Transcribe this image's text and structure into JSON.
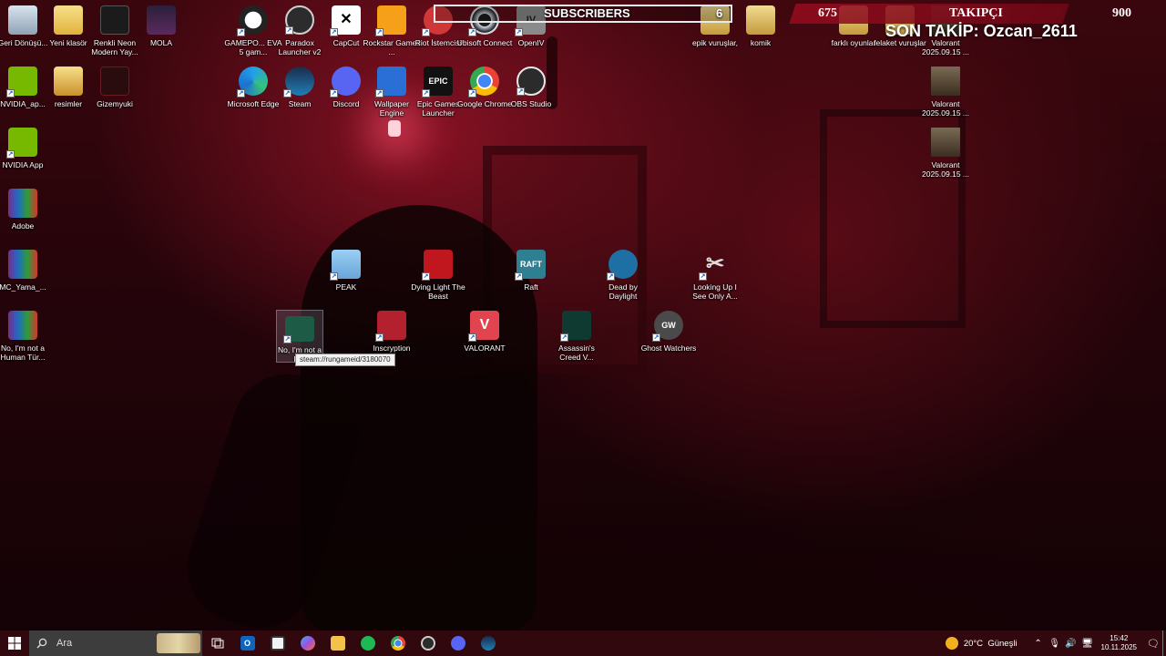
{
  "overlay": {
    "subscribers_label": "SUBSCRIBERS",
    "subscribers_count": "6",
    "follow_left": "675",
    "follow_title": "TAKIPÇI",
    "follow_right": "900",
    "last_follow": "SON TAKİP: Ozcan_2611"
  },
  "tooltip": "steam://rungameid/3180070",
  "icons": {
    "recycle": "Geri Dönüşü...",
    "new_folder": "Yeni klasör",
    "neon": "Renkli Neon Modern Yay...",
    "mola": "MOLA",
    "nvidia_app_shortcut": "NVIDIA_ap...",
    "resimler": "resimler",
    "gizemyuki": "Gizemyuki",
    "nvidia_app": "NVIDIA App",
    "adobe": "Adobe",
    "mc_yama": "MC_Yama_...",
    "no_im_not_human_left": "No, I'm not a Human Tür...",
    "gamepop": "GAMEPO... EVA 5 gam...",
    "paradox": "Paradox Launcher v2",
    "capcut": "CapCut",
    "rockstar": "Rockstar Games ...",
    "riot": "Riot İstemcisi",
    "ubisoft": "Ubisoft Connect",
    "openiv": "OpenIV",
    "epik": "epik vuruşlar,",
    "komik": "komik",
    "farkli": "farklı oyunlar",
    "felaket": "felaket vuruşlar",
    "valorant_clip1": "Valorant 2025.09.15 ...",
    "valorant_clip2": "Valorant 2025.09.15 ...",
    "valorant_clip3": "Valorant 2025.09.15 ...",
    "edge": "Microsoft Edge",
    "steam": "Steam",
    "discord": "Discord",
    "wallpaper": "Wallpaper Engine",
    "epic": "Epic Games Launcher",
    "chrome": "Google Chrome",
    "obs": "OBS Studio",
    "peak": "PEAK",
    "dying_light": "Dying Light The Beast",
    "raft": "Raft",
    "dbd": "Dead by Daylight",
    "looking_up": "Looking Up I See Only A...",
    "no_im_not_human": "No, I'm not a H...",
    "inscryption": "Inscryption",
    "valorant": "VALORANT",
    "assassins": "Assassin's Creed V...",
    "ghost_watchers": "Ghost Watchers"
  },
  "icon_glyphs": {
    "epic": "EPIC",
    "raft": "RAFT",
    "ghost_watchers": "GW",
    "openiv": "IV"
  },
  "taskbar": {
    "search_placeholder": "Ara",
    "weather_temp": "20°C",
    "weather_text": "Güneşli",
    "time": "15:42",
    "date": "10.11.2025"
  },
  "colors": {
    "taskbar_bg": "#30080e",
    "follow_bar": "#960c1e",
    "accent_red": "#b0151f"
  }
}
